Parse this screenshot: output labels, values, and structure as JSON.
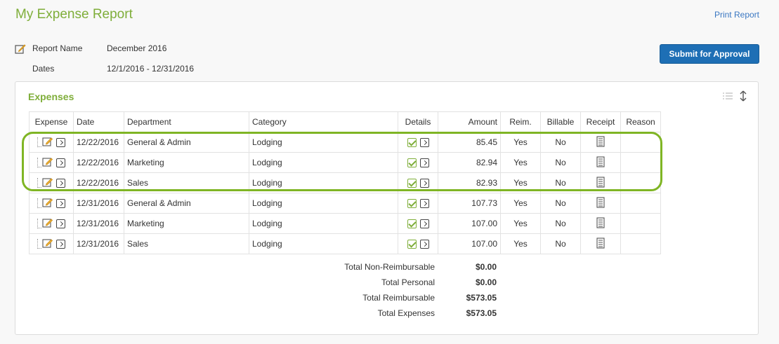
{
  "header": {
    "title": "My Expense Report",
    "print_label": "Print Report",
    "submit_label": "Submit for Approval"
  },
  "report": {
    "name_label": "Report Name",
    "name_value": "December 2016",
    "dates_label": "Dates",
    "dates_value": "12/1/2016 - 12/31/2016"
  },
  "expenses": {
    "title": "Expenses",
    "columns": [
      "Expense",
      "Date",
      "Department",
      "Category",
      "Details",
      "Amount",
      "Reim.",
      "Billable",
      "Receipt",
      "Reason"
    ],
    "rows": [
      {
        "date": "12/22/2016",
        "department": "General & Admin",
        "category": "Lodging",
        "amount": "85.45",
        "reim": "Yes",
        "billable": "No",
        "reason": ""
      },
      {
        "date": "12/22/2016",
        "department": "Marketing",
        "category": "Lodging",
        "amount": "82.94",
        "reim": "Yes",
        "billable": "No",
        "reason": ""
      },
      {
        "date": "12/22/2016",
        "department": "Sales",
        "category": "Lodging",
        "amount": "82.93",
        "reim": "Yes",
        "billable": "No",
        "reason": ""
      },
      {
        "date": "12/31/2016",
        "department": "General & Admin",
        "category": "Lodging",
        "amount": "107.73",
        "reim": "Yes",
        "billable": "No",
        "reason": ""
      },
      {
        "date": "12/31/2016",
        "department": "Marketing",
        "category": "Lodging",
        "amount": "107.00",
        "reim": "Yes",
        "billable": "No",
        "reason": ""
      },
      {
        "date": "12/31/2016",
        "department": "Sales",
        "category": "Lodging",
        "amount": "107.00",
        "reim": "Yes",
        "billable": "No",
        "reason": ""
      }
    ]
  },
  "totals": [
    {
      "label": "Total Non-Reimbursable",
      "value": "$0.00"
    },
    {
      "label": "Total Personal",
      "value": "$0.00"
    },
    {
      "label": "Total Reimbursable",
      "value": "$573.05"
    },
    {
      "label": "Total Expenses",
      "value": "$573.05"
    }
  ],
  "colors": {
    "accent_green": "#7fae3a",
    "highlight_green": "#7fb524",
    "button_blue": "#1e6fb5",
    "link_blue": "#3b78c2"
  },
  "icons": [
    "edit-icon",
    "arrow-right-icon",
    "check-icon",
    "receipt-icon",
    "list-icon",
    "sort-icon"
  ]
}
